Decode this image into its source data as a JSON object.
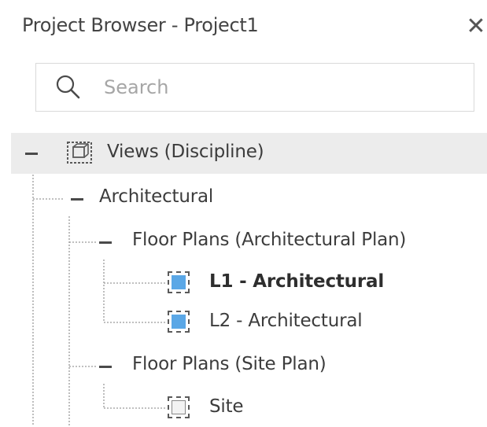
{
  "window": {
    "title": "Project Browser - Project1",
    "close_glyph": "✕"
  },
  "search": {
    "placeholder": "Search",
    "value": ""
  },
  "tree": {
    "views_label": "Views (Discipline)",
    "architectural_label": "Architectural",
    "floor_plans_arch_label": "Floor Plans (Architectural Plan)",
    "l1_label": "L1 - Architectural",
    "l2_label": "L2 - Architectural",
    "floor_plans_site_label": "Floor Plans (Site Plan)",
    "site_label": "Site"
  },
  "colors": {
    "accent_view_icon": "#5aa7e6",
    "selected_row_bg": "#ececec"
  },
  "icons": {
    "views": "views-icon",
    "plan": "floor-plan-icon",
    "site": "site-plan-icon",
    "search": "search-icon",
    "close": "close-icon"
  }
}
